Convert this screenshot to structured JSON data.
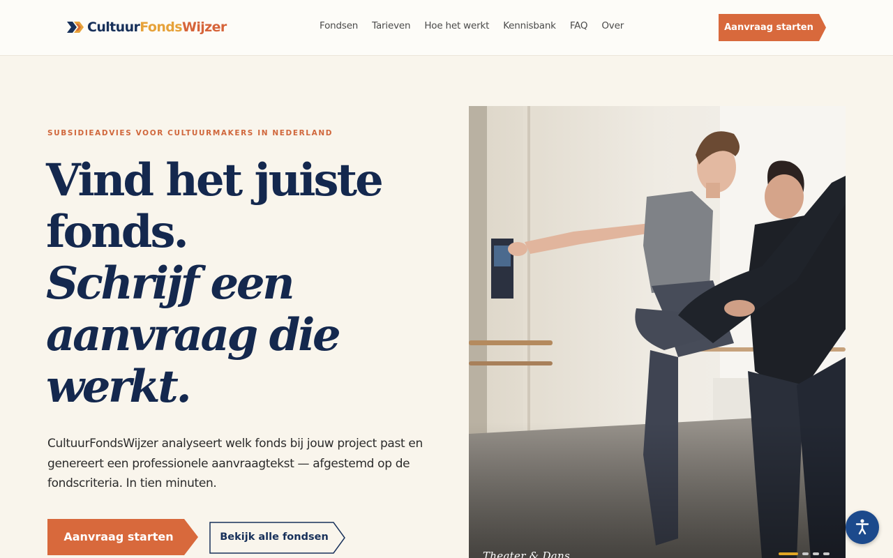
{
  "header": {
    "logo": {
      "part1": "Cultuur",
      "part2": "Fonds",
      "part3": "Wijzer"
    },
    "nav": [
      "Fondsen",
      "Tarieven",
      "Hoe het werkt",
      "Kennisbank",
      "FAQ",
      "Over"
    ],
    "cta_label": "Aanvraag starten"
  },
  "hero": {
    "eyebrow": "SUBSIDIEADVIES VOOR CULTUURMAKERS IN NEDERLAND",
    "headline_line1": "Vind het juiste",
    "headline_line2": "fonds.",
    "headline_italic1": "Schrijf een",
    "headline_italic2": "aanvraag die",
    "headline_italic3": "werkt.",
    "lead": "CultuurFondsWijzer analyseert welk fonds bij jouw project past en genereert een professionele aanvraagtekst — afgestemd op de fondscriteria. In tien minuten.",
    "primary_button": "Aanvraag starten",
    "secondary_button": "Bekijk alle fondsen",
    "photo": {
      "caption": "Theater & Dans",
      "slides_total": 4,
      "active_slide": 1
    }
  },
  "colors": {
    "accent": "#d8693c",
    "navy": "#14284e",
    "gold": "#e0a524",
    "background": "#f9f5ec"
  },
  "icons": {
    "logo_mark": "double-chevron-logo-icon",
    "accessibility": "accessibility-person-icon"
  }
}
